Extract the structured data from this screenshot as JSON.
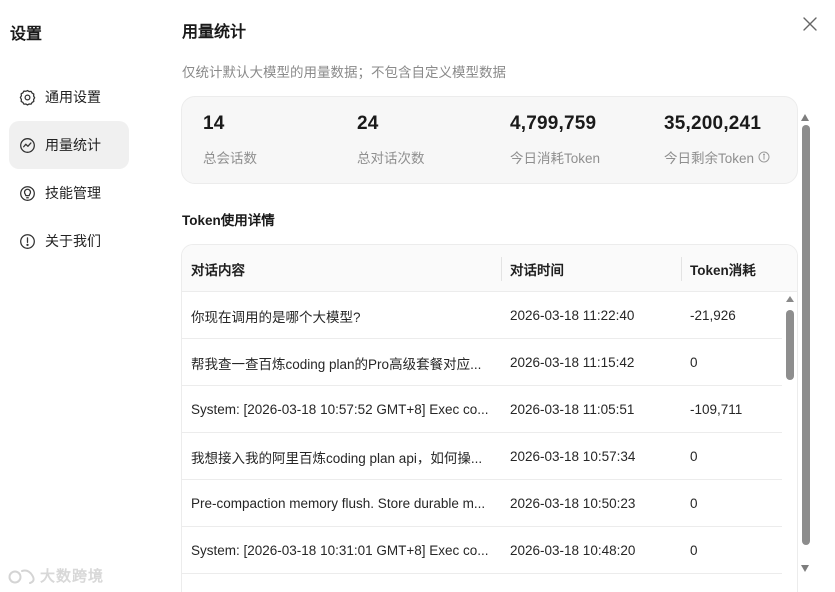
{
  "sidebar": {
    "title": "设置",
    "items": [
      {
        "label": "通用设置",
        "icon": "gear-icon",
        "active": false
      },
      {
        "label": "用量统计",
        "icon": "chart-icon",
        "active": true
      },
      {
        "label": "技能管理",
        "icon": "skill-icon",
        "active": false
      },
      {
        "label": "关于我们",
        "icon": "info-icon",
        "active": false
      }
    ]
  },
  "main": {
    "title": "用量统计",
    "subtitle": "仅统计默认大模型的用量数据；不包含自定义模型数据",
    "stats": [
      {
        "value": "14",
        "label": "总会话数"
      },
      {
        "value": "24",
        "label": "总对话次数"
      },
      {
        "value": "4,799,759",
        "label": "今日消耗Token"
      },
      {
        "value": "35,200,241",
        "label": "今日剩余Token"
      }
    ],
    "section_title": "Token使用详情",
    "table": {
      "headers": [
        "对话内容",
        "对话时间",
        "Token消耗"
      ],
      "rows": [
        [
          "你现在调用的是哪个大模型?",
          "2026-03-18 11:22:40",
          "-21,926"
        ],
        [
          "帮我查一查百炼coding plan的Pro高级套餐对应...",
          "2026-03-18 11:15:42",
          "0"
        ],
        [
          "System: [2026-03-18 10:57:52 GMT+8] Exec co...",
          "2026-03-18 11:05:51",
          "-109,711"
        ],
        [
          "我想接入我的阿里百炼coding plan api，如何操...",
          "2026-03-18 10:57:34",
          "0"
        ],
        [
          "Pre-compaction memory flush. Store durable m...",
          "2026-03-18 10:50:23",
          "0"
        ],
        [
          "System: [2026-03-18 10:31:01 GMT+8] Exec co...",
          "2026-03-18 10:48:20",
          "0"
        ],
        [
          "",
          "",
          ""
        ]
      ]
    }
  },
  "watermark": {
    "text": "大数跨境"
  },
  "colors": {
    "active_bg": "#f0f0f0",
    "card_bg": "#f7f7f7",
    "muted_text": "#8a8a8a",
    "border": "#ececec"
  }
}
